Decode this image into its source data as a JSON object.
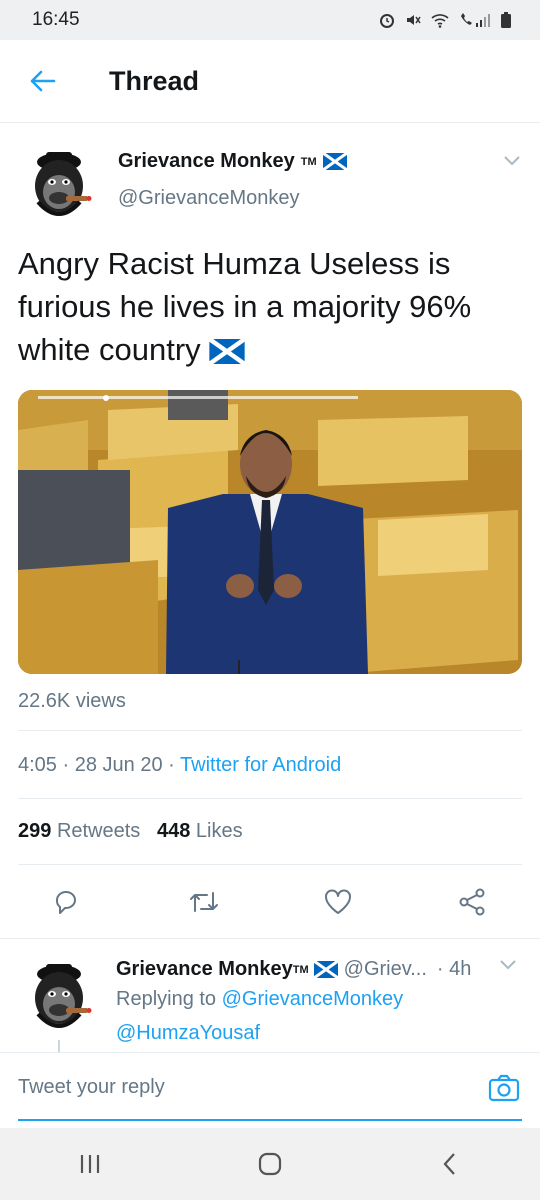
{
  "status_bar": {
    "time": "16:45"
  },
  "header": {
    "title": "Thread"
  },
  "tweet": {
    "author_name": "Grievance Monkey",
    "author_tm": "TM",
    "author_handle": "@GrievanceMonkey",
    "text": "Angry Racist Humza Useless is furious he lives in a majority 96% white country",
    "views": "22.6K views",
    "time": "4:05",
    "date": "28 Jun 20",
    "source": "Twitter for Android",
    "retweets_count": "299",
    "retweets_label": "Retweets",
    "likes_count": "448",
    "likes_label": "Likes"
  },
  "reply": {
    "author_name": "Grievance Monkey",
    "author_tm": "TM",
    "handle": "@Griev...",
    "time": "4h",
    "replying_prefix": "Replying to",
    "replying_mention": "@GrievanceMonkey",
    "second_mention": "@HumzaYousaf"
  },
  "reply_bar": {
    "placeholder": "Tweet your reply"
  },
  "icons": {
    "back": "arrow-left-icon",
    "caret": "chevron-down-icon",
    "flag": "scotland-flag-icon",
    "reply": "reply-icon",
    "retweet": "retweet-icon",
    "like": "heart-icon",
    "share": "share-icon",
    "camera": "camera-icon"
  },
  "colors": {
    "accent": "#1da1f2",
    "text": "#14171a",
    "muted": "#657786",
    "flag_blue": "#0065bd"
  }
}
